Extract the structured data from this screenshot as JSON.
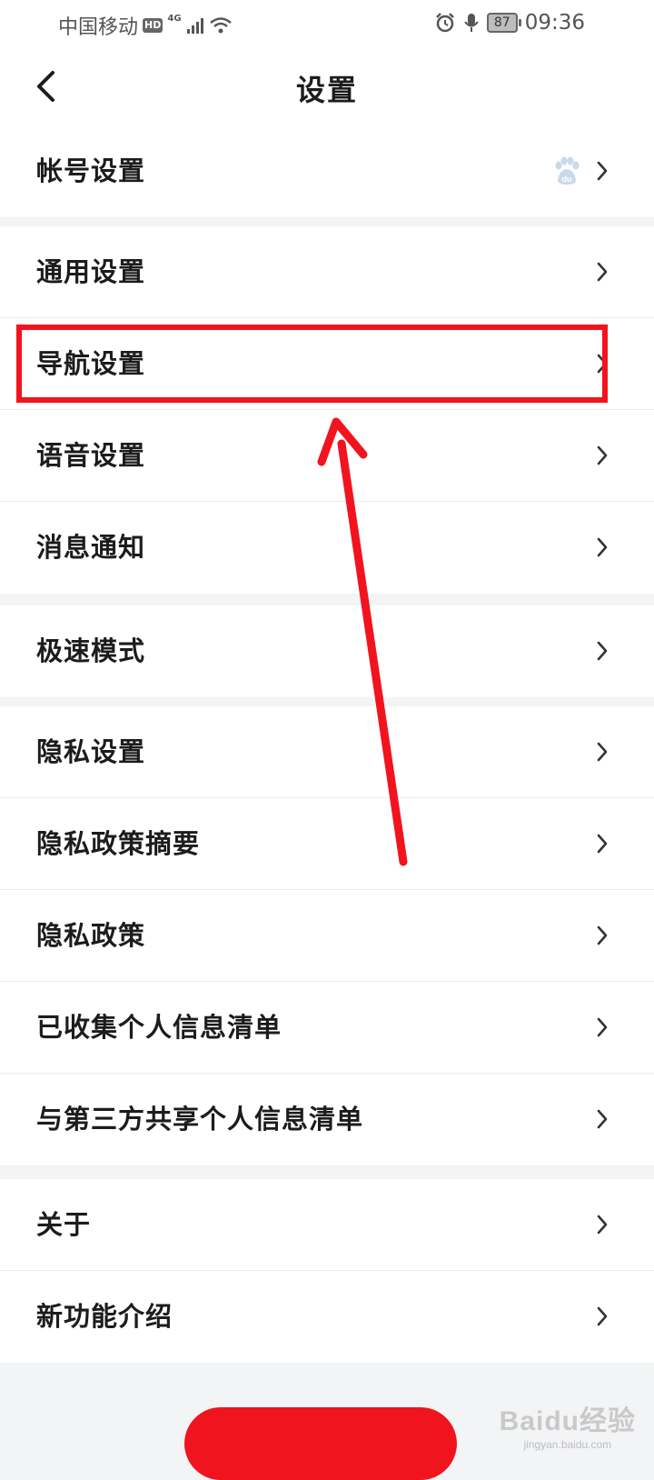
{
  "status_bar": {
    "carrier": "中国移动",
    "hd_badge": "HD",
    "network": "4G",
    "battery": "87",
    "time": "09:36"
  },
  "header": {
    "title": "设置"
  },
  "groups": [
    {
      "items": [
        {
          "label": "帐号设置",
          "icon": "baidu-paw-icon"
        }
      ]
    },
    {
      "items": [
        {
          "label": "通用设置"
        },
        {
          "label": "导航设置",
          "highlighted": true
        },
        {
          "label": "语音设置"
        },
        {
          "label": "消息通知"
        }
      ]
    },
    {
      "items": [
        {
          "label": "极速模式"
        }
      ]
    },
    {
      "items": [
        {
          "label": "隐私设置"
        },
        {
          "label": "隐私政策摘要"
        },
        {
          "label": "隐私政策"
        },
        {
          "label": "已收集个人信息清单"
        },
        {
          "label": "与第三方共享个人信息清单"
        }
      ]
    },
    {
      "items": [
        {
          "label": "关于"
        },
        {
          "label": "新功能介绍"
        }
      ]
    }
  ],
  "annotation": {
    "color": "#f1141e"
  },
  "watermark": {
    "logo_text": "Baidu经验",
    "url": "jingyan.baidu.com"
  },
  "colors": {
    "accent": "#f0141e",
    "background": "#f3f4f6",
    "text": "#1c1c1e"
  }
}
